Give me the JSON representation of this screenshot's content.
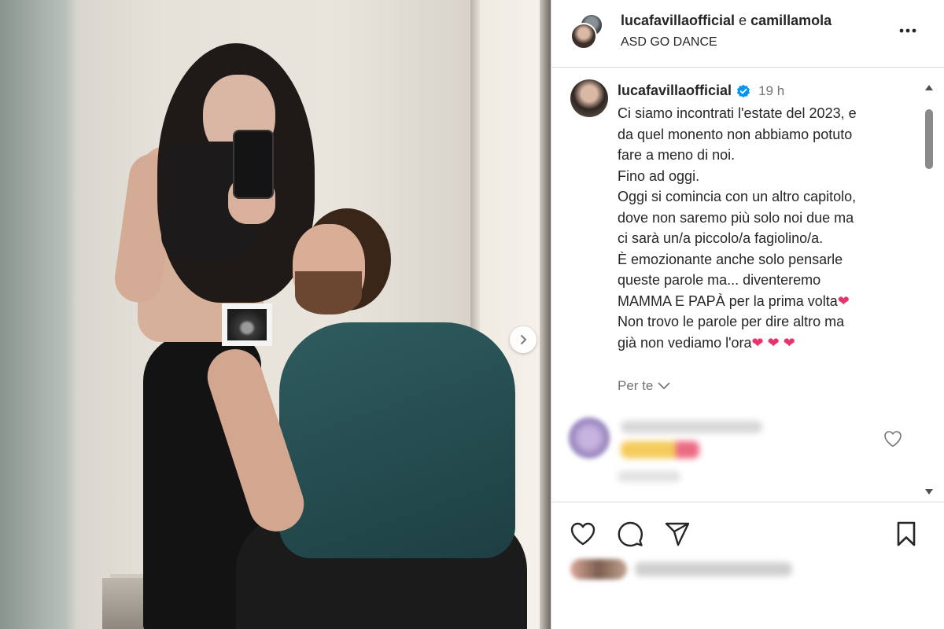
{
  "header": {
    "user1": "lucafavillaofficial",
    "conjunction": "e",
    "user2": "camillamola",
    "location": "ASD GO DANCE"
  },
  "caption": {
    "username": "lucafavillaofficial",
    "time": "19 h",
    "lines": [
      "Ci siamo incontrati l'estate del 2023, e",
      "da quel monento non abbiamo potuto",
      "fare a meno di noi.",
      "Fino ad oggi.",
      "Oggi si comincia con un altro capitolo,",
      "dove non saremo più solo noi due ma",
      "ci sarà un/a piccolo/a fagiolino/a.",
      "È emozionante anche solo pensarle",
      "queste parole ma... diventeremo",
      "MAMMA E PAPÀ per la prima volta",
      "Non trovo le parole per dire altro ma",
      "già non vediamo l'ora"
    ],
    "heart_emoji": "❤",
    "heart_color": "#e8336b"
  },
  "per_te": "Per te",
  "colors": {
    "text": "#262626",
    "muted": "#737373",
    "verified": "#0095f6",
    "divider": "#dbdbdb"
  },
  "icons": {
    "like": "heart-outline-icon",
    "comment": "speech-bubble-icon",
    "share": "paper-plane-icon",
    "save": "bookmark-icon",
    "more": "ellipsis-icon",
    "next": "chevron-right-icon",
    "verified": "verified-badge-icon"
  }
}
